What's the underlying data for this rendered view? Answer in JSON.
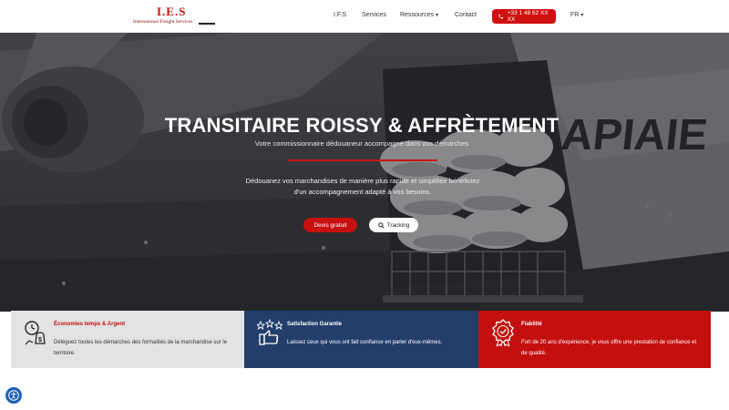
{
  "header": {
    "logo_mark": "I.E.S",
    "logo_sub": "International Freight Services",
    "nav": [
      "I.F.S",
      "Services",
      "Ressources",
      "Contact"
    ],
    "phone": "+33 1 48 62 XX XX",
    "lang": "FR"
  },
  "hero": {
    "title": "TRANSITAIRE ROISSY & AFFRÈTEMENT",
    "subtitle": "Votre commissionnaire dédouaneur accompagne dans vos démarches",
    "description": "Dédouanez vos marchandises de manière plus rapide et simplifiée bénéficiez d'un accompagnement adapté à vos besoins.",
    "btn_devis": "Devis gratuit",
    "btn_tracking": "Tracking"
  },
  "features": [
    {
      "title": "Économies temps & Argent",
      "text": "Déléguez toutes les démarches des formalités de la marchandise sur le territoire."
    },
    {
      "title": "Satisfaction Garantie",
      "text": "Laissez ceux qui vous ont fait confiance en parler d'eux-mêmes."
    },
    {
      "title": "Fiabilité",
      "text": "Fort de 20 ans d'expérience, je vous offre une prestation de confiance et de qualité."
    }
  ],
  "colors": {
    "brand_red": "#c40f0f",
    "navy": "#233e6b",
    "light_gray": "#e3e3e3"
  }
}
